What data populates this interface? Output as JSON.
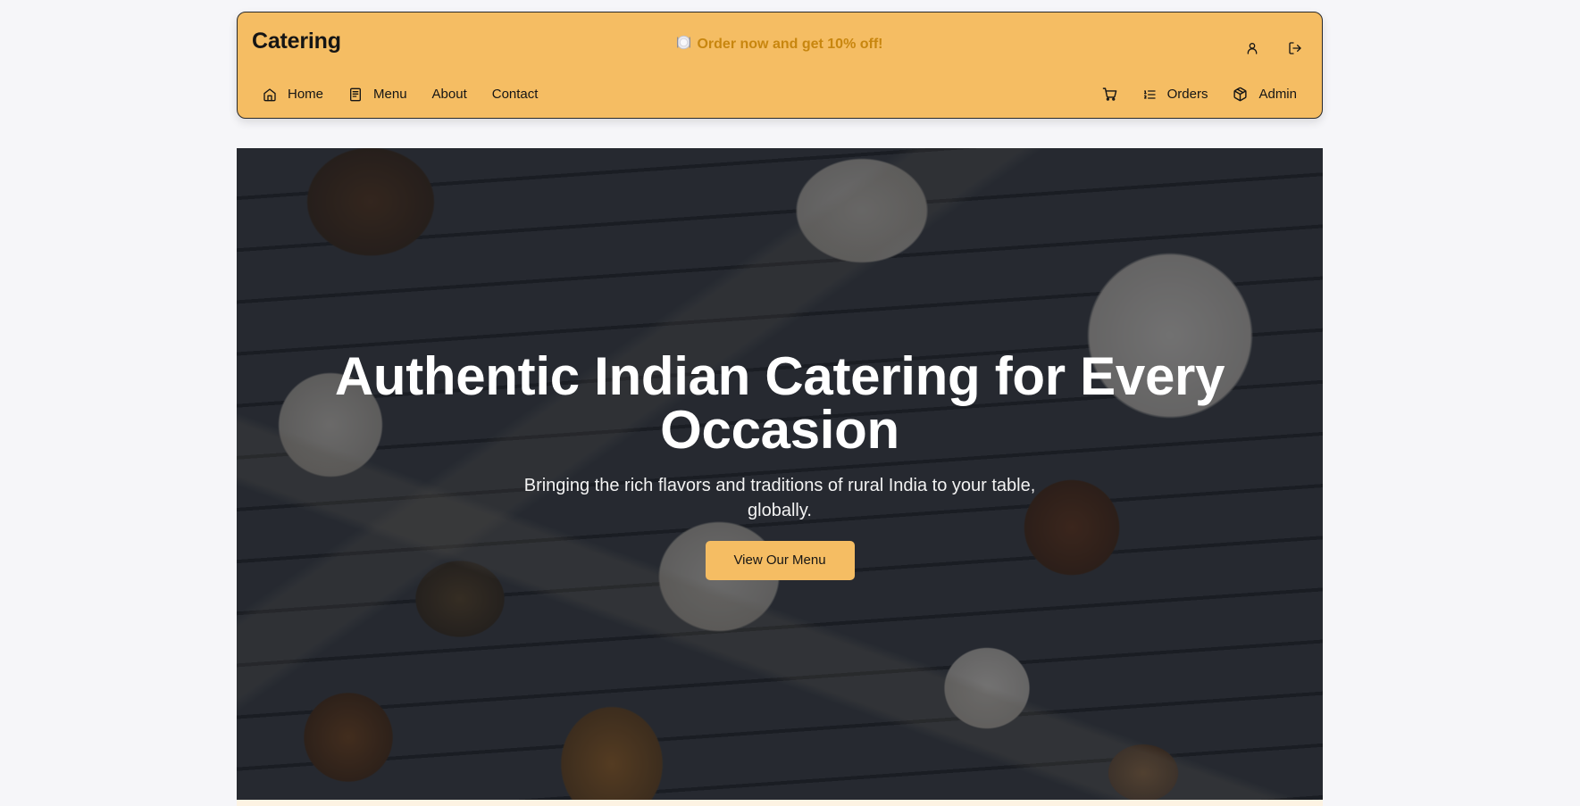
{
  "header": {
    "brand": "Catering",
    "promo": "Order now and get 10% off!",
    "promo_icon": "plate-icon",
    "account_icon": "user-icon",
    "logout_icon": "logout-icon"
  },
  "nav": {
    "left": [
      {
        "label": "Home",
        "icon": "home-icon"
      },
      {
        "label": "Menu",
        "icon": "menu-book-icon"
      },
      {
        "label": "About"
      },
      {
        "label": "Contact"
      }
    ],
    "right": [
      {
        "label": "",
        "icon": "cart-icon"
      },
      {
        "label": "Orders",
        "icon": "list-icon"
      },
      {
        "label": "Admin",
        "icon": "package-icon"
      }
    ]
  },
  "hero": {
    "title": "Authentic Indian Catering for Every Occasion",
    "subtitle": "Bringing the rich flavors and traditions of rural India to your table, globally.",
    "cta": "View Our Menu"
  },
  "colors": {
    "accent": "#f5bd63",
    "promo_text": "#c8860f",
    "page_bg": "#f6f6f9"
  }
}
